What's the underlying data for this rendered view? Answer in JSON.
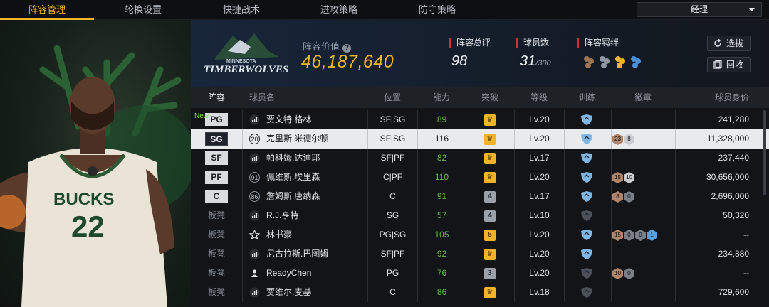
{
  "tabs": [
    {
      "label": "阵容管理",
      "active": true
    },
    {
      "label": "轮换设置",
      "active": false
    },
    {
      "label": "快捷战术",
      "active": false
    },
    {
      "label": "进攻策略",
      "active": false
    },
    {
      "label": "防守策略",
      "active": false
    }
  ],
  "dropdown": {
    "value": "经理"
  },
  "player_art": {
    "jersey_text": "BUCKS",
    "jersey_number": "22"
  },
  "team": {
    "logo_line1": "MINNESOTA",
    "logo_line2": "TIMBERWOLVES",
    "value_label": "阵容价值",
    "value": "46,187,640",
    "rating_label": "阵容总评",
    "rating": "98",
    "players_label": "球员数",
    "players": "31",
    "players_max": "/300",
    "bond_label": "阵容羁绊",
    "select_button": "选拔",
    "recycle_button": "回收"
  },
  "table": {
    "headers": [
      "阵容",
      "球员名",
      "位置",
      "能力",
      "突破",
      "等级",
      "训练",
      "徽章",
      "球员身价"
    ],
    "rows": [
      {
        "slot": "PG",
        "slot_style": "light",
        "new": "New",
        "icon": "bars",
        "name": "贾文特.格林",
        "position": "SF|SG",
        "ability": "89",
        "ability_green": true,
        "breakthrough": "crown",
        "brk_style": "gold",
        "level": "Lv.20",
        "training": "active",
        "badges": [],
        "value": "241,280",
        "selected": false
      },
      {
        "slot": "SG",
        "slot_style": "dark",
        "new": "",
        "icon": "20",
        "name": "克里斯.米德尔顿",
        "position": "SF|SG",
        "ability": "116",
        "ability_green": false,
        "breakthrough": "crown",
        "brk_style": "gold",
        "level": "Lv.20",
        "training": "active",
        "badges": [
          {
            "t": "23",
            "c": "#b0856c"
          },
          {
            "t": "8",
            "c": "#c9ccd1"
          }
        ],
        "value": "11,328,000",
        "selected": true
      },
      {
        "slot": "SF",
        "slot_style": "light",
        "new": "",
        "icon": "bars",
        "name": "帕科姆.达迪耶",
        "position": "SF|PF",
        "ability": "82",
        "ability_green": true,
        "breakthrough": "crown",
        "brk_style": "gold",
        "level": "Lv.17",
        "training": "active",
        "badges": [],
        "value": "237,440",
        "selected": false
      },
      {
        "slot": "PF",
        "slot_style": "light",
        "new": "",
        "icon": "91",
        "name": "佩维斯.埃里森",
        "position": "C|PF",
        "ability": "110",
        "ability_green": true,
        "breakthrough": "crown",
        "brk_style": "gold",
        "level": "Lv.20",
        "training": "active",
        "badges": [
          {
            "t": "15",
            "c": "#b0856c"
          },
          {
            "t": "10",
            "c": "#c9ccd1"
          }
        ],
        "value": "30,656,000",
        "selected": false
      },
      {
        "slot": "C",
        "slot_style": "light",
        "new": "",
        "icon": "86",
        "name": "詹姆斯.唐纳森",
        "position": "C",
        "ability": "91",
        "ability_green": true,
        "breakthrough": "4",
        "brk_style": "grey",
        "level": "Lv.17",
        "training": "active",
        "badges": [
          {
            "t": "8",
            "c": "#b0856c"
          },
          {
            "t": "0",
            "c": "#7a7f86"
          }
        ],
        "value": "2,696,000",
        "selected": false
      },
      {
        "slot": "板凳",
        "slot_style": "bench",
        "new": "",
        "icon": "bars",
        "name": "R.J.亨特",
        "position": "SG",
        "ability": "57",
        "ability_green": true,
        "breakthrough": "4",
        "brk_style": "grey",
        "level": "Lv.10",
        "training": "inactive",
        "badges": [],
        "value": "50,320",
        "selected": false
      },
      {
        "slot": "板凳",
        "slot_style": "bench",
        "new": "",
        "icon": "star",
        "name": "林书豪",
        "position": "PG|SG",
        "ability": "105",
        "ability_green": true,
        "breakthrough": "5",
        "brk_style": "gold",
        "level": "Lv.20",
        "training": "active",
        "badges": [
          {
            "t": "15",
            "c": "#b0856c"
          },
          {
            "t": "0",
            "c": "#7a7f86"
          },
          {
            "t": "0",
            "c": "#7a7f86"
          },
          {
            "t": "1",
            "c": "#5aa0e0"
          }
        ],
        "value": "--",
        "selected": false
      },
      {
        "slot": "板凳",
        "slot_style": "bench",
        "new": "",
        "icon": "bars",
        "name": "尼古拉斯.巴图姆",
        "position": "SF|PF",
        "ability": "92",
        "ability_green": true,
        "breakthrough": "crown",
        "brk_style": "gold",
        "level": "Lv.20",
        "training": "active",
        "badges": [],
        "value": "234,880",
        "selected": false
      },
      {
        "slot": "板凳",
        "slot_style": "bench",
        "new": "",
        "icon": "person",
        "name": "ReadyChen",
        "position": "PG",
        "ability": "76",
        "ability_green": true,
        "breakthrough": "3",
        "brk_style": "grey",
        "level": "Lv.20",
        "training": "inactive",
        "badges": [
          {
            "t": "10",
            "c": "#b0856c"
          },
          {
            "t": "0",
            "c": "#7a7f86"
          }
        ],
        "value": "--",
        "selected": false
      },
      {
        "slot": "板凳",
        "slot_style": "bench",
        "new": "",
        "icon": "bars",
        "name": "贾维尔.麦基",
        "position": "C",
        "ability": "86",
        "ability_green": true,
        "breakthrough": "crown",
        "brk_style": "gold",
        "level": "Lv.18",
        "training": "inactive",
        "badges": [],
        "value": "729,600",
        "selected": false
      }
    ]
  },
  "colors": {
    "accent": "#f0b429",
    "red_marker": "#d0312d",
    "green": "#5fb845"
  }
}
